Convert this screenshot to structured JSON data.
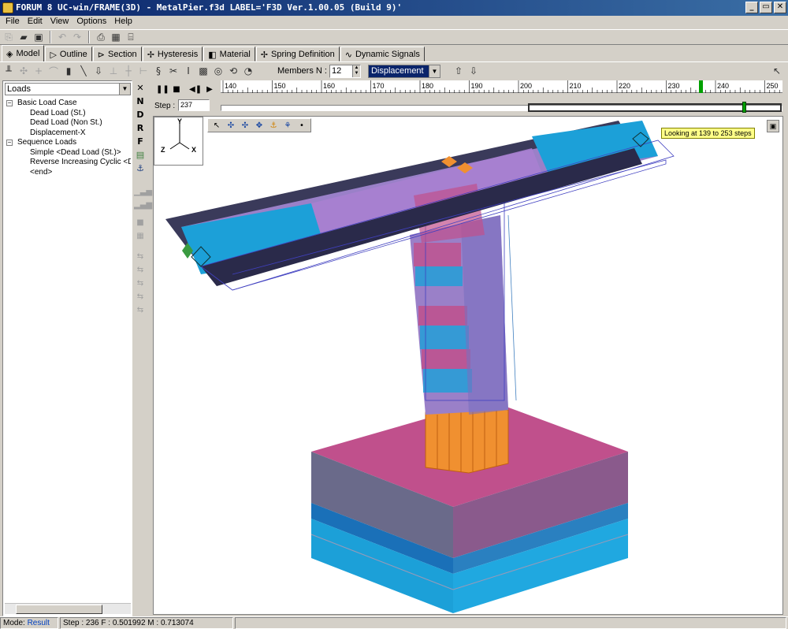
{
  "window": {
    "title": "FORUM 8  UC-win/FRAME(3D) - MetalPier.f3d   LABEL='F3D Ver.1.00.05 (Build 9)'",
    "buttons": [
      "_",
      "▭",
      "✕"
    ]
  },
  "menu": [
    "File",
    "Edit",
    "View",
    "Options",
    "Help"
  ],
  "tabs": [
    {
      "label": "Model",
      "icon": "model-icon"
    },
    {
      "label": "Outline",
      "icon": "outline-icon"
    },
    {
      "label": "Section",
      "icon": "section-icon"
    },
    {
      "label": "Hysteresis",
      "icon": "hysteresis-icon"
    },
    {
      "label": "Material",
      "icon": "material-icon"
    },
    {
      "label": "Spring Definition",
      "icon": "spring-icon"
    },
    {
      "label": "Dynamic Signals",
      "icon": "signal-icon"
    }
  ],
  "toolbar2": {
    "members_label": "Members N :",
    "members_value": "12",
    "result_type": "Displacement"
  },
  "loads": {
    "combo": "Loads",
    "tree": [
      {
        "label": "Basic Load Case",
        "level": 0,
        "expander": "−"
      },
      {
        "label": "Dead Load (St.)",
        "level": 1
      },
      {
        "label": "Dead Load (Non St.)",
        "level": 1
      },
      {
        "label": "Displacement-X",
        "level": 1
      },
      {
        "label": "Sequence Loads",
        "level": 0,
        "expander": "−"
      },
      {
        "label": "Simple <Dead Load (St.)>",
        "level": 1
      },
      {
        "label": "Reverse Increasing Cyclic <Displac",
        "level": 1
      },
      {
        "label": "<end>",
        "level": 1
      }
    ]
  },
  "side_letters": [
    "N",
    "D",
    "R",
    "F"
  ],
  "animation": {
    "step_label": "Step :",
    "step_value": "237",
    "ruler_ticks": [
      "140",
      "150",
      "160",
      "170",
      "180",
      "190",
      "200",
      "210",
      "220",
      "230",
      "240",
      "250"
    ],
    "tooltip": "Looking at 139 to 253 steps"
  },
  "axes": {
    "y": "Y",
    "z": "Z",
    "x": "X"
  },
  "status": {
    "mode_label": "Mode:",
    "mode_value": "Result",
    "info": "Step : 236  F : 0.501992  M : 0.713074"
  },
  "colors": {
    "magenta": "#c0508c",
    "blue": "#1ca0d8",
    "slate": "#6a6a8a",
    "orange": "#f09030",
    "navy": "#3a3a5a"
  }
}
